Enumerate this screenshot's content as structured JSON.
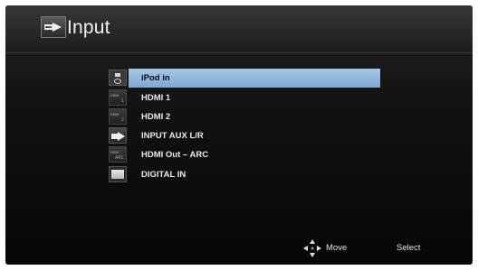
{
  "header": {
    "title": "Input",
    "icon": "input-source-icon"
  },
  "inputs": [
    {
      "label": "iPod in",
      "icon": "ipod-icon",
      "selected": true
    },
    {
      "label": "HDMI 1",
      "icon": "hdmi-icon",
      "icon_text": "HDMI",
      "icon_num": "1",
      "selected": false
    },
    {
      "label": "HDMI 2",
      "icon": "hdmi-icon",
      "icon_text": "HDMI",
      "icon_num": "2",
      "selected": false
    },
    {
      "label": "INPUT AUX L/R",
      "icon": "aux-input-icon",
      "selected": false
    },
    {
      "label": "HDMI Out – ARC",
      "icon": "hdmi-icon",
      "icon_text": "HDMI",
      "icon_num": "ARC",
      "selected": false
    },
    {
      "label": "DIGITAL IN",
      "icon": "digital-in-icon",
      "selected": false
    }
  ],
  "footer": {
    "move_label": "Move",
    "move_icon": "directional-pad-icon",
    "select_label": "Select"
  },
  "colors": {
    "selection": "#8fb5e0",
    "background": "#111111",
    "text": "#eaeaea"
  }
}
